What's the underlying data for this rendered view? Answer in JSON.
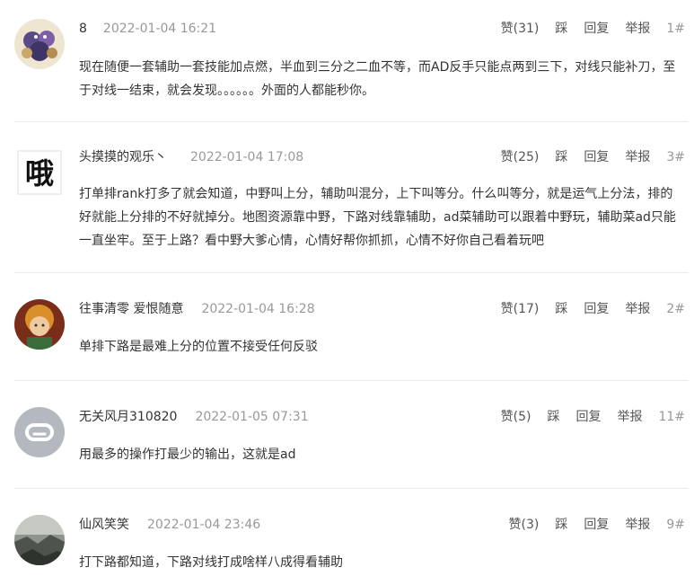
{
  "comments": [
    {
      "username": "8",
      "time": "2022-01-04 16:21",
      "like_label": "赞(31)",
      "dislike_label": "踩",
      "reply_label": "回复",
      "report_label": "举报",
      "floor": "1#",
      "text": "现在随便一套辅助一套技能加点燃，半血到三分之二血不等，而AD反手只能点两到三下，对线只能补刀，至于对线一结束，就会发现。。。。。。外面的人都能秒你。"
    },
    {
      "username": "头摸摸的观乐丶",
      "time": "2022-01-04 17:08",
      "like_label": "赞(25)",
      "dislike_label": "踩",
      "reply_label": "回复",
      "report_label": "举报",
      "floor": "3#",
      "avatar_char": "哦",
      "text": "打单排rank打多了就会知道，中野叫上分，辅助叫混分，上下叫等分。什么叫等分，就是运气上分法，排的好就能上分排的不好就掉分。地图资源靠中野，下路对线靠辅助，ad菜辅助可以跟着中野玩，辅助菜ad只能一直坐牢。至于上路？看中野大爹心情，心情好帮你抓抓，心情不好你自己看着玩吧"
    },
    {
      "username": "往事清零 爱恨随意",
      "time": "2022-01-04 16:28",
      "like_label": "赞(17)",
      "dislike_label": "踩",
      "reply_label": "回复",
      "report_label": "举报",
      "floor": "2#",
      "text": "单排下路是最难上分的位置不接受任何反驳"
    },
    {
      "username": "无关风月310820",
      "time": "2022-01-05 07:31",
      "like_label": "赞(5)",
      "dislike_label": "踩",
      "reply_label": "回复",
      "report_label": "举报",
      "floor": "11#",
      "text": "用最多的操作打最少的输出，这就是ad"
    },
    {
      "username": "仙风笑笑",
      "time": "2022-01-04 23:46",
      "like_label": "赞(3)",
      "dislike_label": "踩",
      "reply_label": "回复",
      "report_label": "举报",
      "floor": "9#",
      "text": "打下路都知道，下路对线打成啥样八成得看辅助"
    }
  ]
}
